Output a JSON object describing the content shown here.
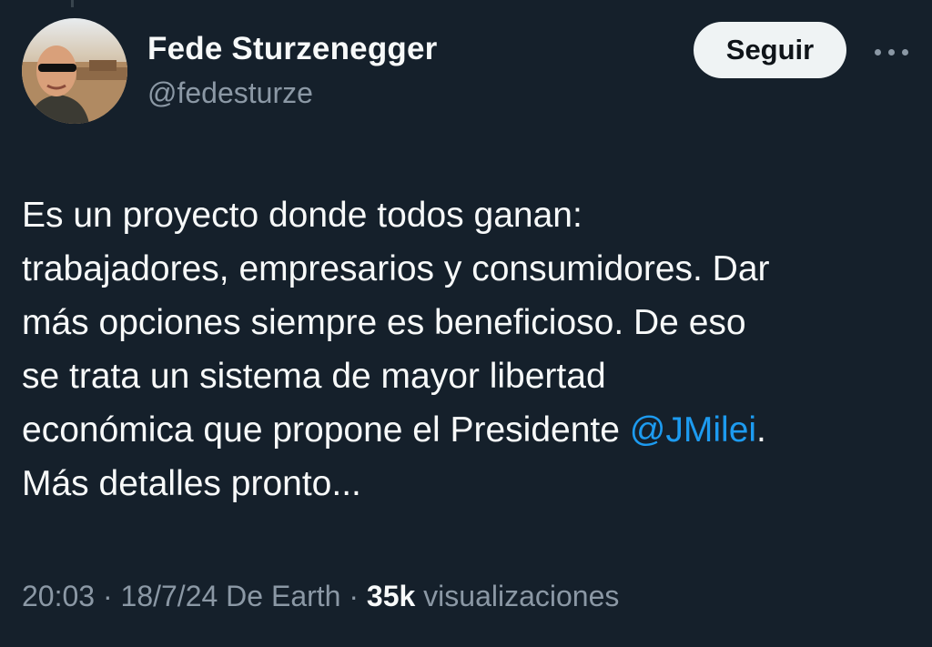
{
  "author": {
    "display_name": "Fede Sturzenegger",
    "handle": "@fedesturze"
  },
  "header": {
    "follow_label": "Seguir",
    "more_icon": "more-options-icon"
  },
  "tweet": {
    "lines": {
      "l1": "Es un proyecto donde todos ganan:",
      "l2": "trabajadores, empresarios y consumidores. Dar",
      "l3": "más opciones siempre es beneficioso. De eso",
      "l4": "se trata un sistema de mayor libertad",
      "l5_pre": "económica que propone el Presidente ",
      "l5_mention": "@JMilei",
      "l5_post": ".",
      "l6": "Más detalles pronto..."
    }
  },
  "meta": {
    "time": "20:03",
    "sep1": " · ",
    "date": "18/7/24",
    "source": " De Earth",
    "sep2": " · ",
    "views_count": "35k",
    "views_label": " visualizaciones"
  },
  "colors": {
    "background": "#15202b",
    "text": "#f7f9f9",
    "secondary": "#8b98a5",
    "link": "#1d9bf0",
    "button_bg": "#eff3f4"
  }
}
